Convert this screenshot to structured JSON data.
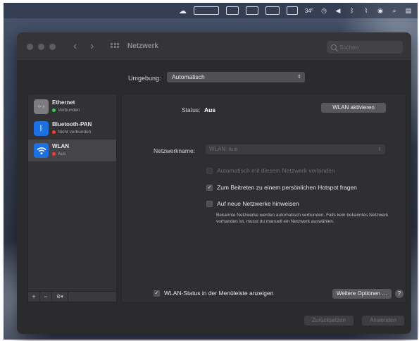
{
  "menubar": {
    "items": [
      {
        "name": "cloud-icon",
        "glyph": "☁"
      },
      {
        "name": "cpu-meter",
        "text": ""
      },
      {
        "name": "memory-meter",
        "text": ""
      },
      {
        "name": "disk-meter",
        "text": ""
      },
      {
        "name": "network-meter",
        "text": ""
      },
      {
        "name": "temperature",
        "text": "34°"
      },
      {
        "name": "time-machine-icon",
        "glyph": "◷"
      },
      {
        "name": "volume-icon",
        "glyph": "◀"
      },
      {
        "name": "bluetooth-icon",
        "glyph": "ᛒ"
      },
      {
        "name": "wifi-off-icon",
        "glyph": "⌇"
      },
      {
        "name": "user-icon",
        "glyph": "◉"
      },
      {
        "name": "spotlight-icon",
        "glyph": "⌕"
      },
      {
        "name": "control-center-icon",
        "glyph": "▤"
      }
    ]
  },
  "window": {
    "title": "Netzwerk",
    "search_placeholder": "Suchen",
    "back_glyph": "‹",
    "forward_glyph": "›"
  },
  "location": {
    "label": "Umgebung:",
    "value": "Automatisch"
  },
  "services": [
    {
      "name": "Ethernet",
      "status": "Verbunden",
      "status_color": "#34c759",
      "icon": "‹··›",
      "icon_bg": "#7c7c80"
    },
    {
      "name": "Bluetooth-PAN",
      "status": "Nicht verbunden",
      "status_color": "#ff3b30",
      "icon": "ᛒ",
      "icon_bg": "#1e6fe0"
    },
    {
      "name": "WLAN",
      "status": "Aus",
      "status_color": "#ff3b30",
      "icon": "◠",
      "icon_bg": "#1e6fe0",
      "selected": true
    }
  ],
  "sidebar_footer": {
    "add": "+",
    "remove": "−",
    "action": "⚙︎▾"
  },
  "detail": {
    "status_label": "Status:",
    "status_value": "Aus",
    "toggle_button": "WLAN aktivieren",
    "network_name_label": "Netzwerkname:",
    "network_name_value": "WLAN: aus",
    "checkboxes": [
      {
        "label": "Automatisch mit diesem Netzwerk verbinden",
        "checked": false,
        "disabled": true
      },
      {
        "label": "Zum Beitreten zu einem persönlichen Hotspot fragen",
        "checked": true,
        "disabled": false
      },
      {
        "label": "Auf neue Netzwerke hinweisen",
        "checked": false,
        "disabled": false
      }
    ],
    "hint": "Bekannte Netzwerke werden automatisch verbunden. Falls kein bekanntes Netzwerk vorhanden ist, musst du manuell ein Netzwerk auswählen.",
    "menubar_checkbox": {
      "label": "WLAN-Status in der Menüleiste anzeigen",
      "checked": true
    },
    "advanced_button": "Weitere Optionen …",
    "help_glyph": "?"
  },
  "footer": {
    "revert": "Zurücksetzen",
    "apply": "Anwenden"
  }
}
